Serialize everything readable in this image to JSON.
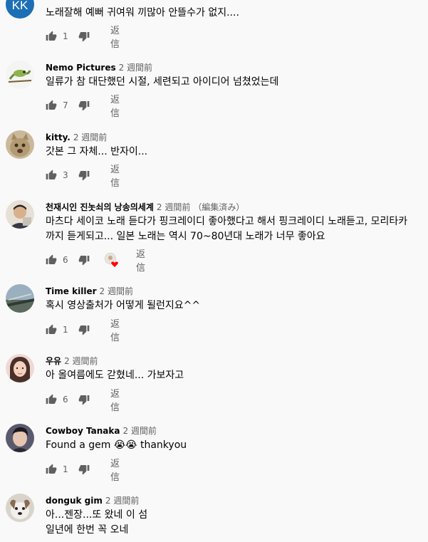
{
  "comments": [
    {
      "avatar": "avatar-kk",
      "avatar_text": "KK",
      "author": "",
      "time": "",
      "text": "노래잘해 예뻐 귀여워 끼많아 안뜰수가 없지....",
      "likes": "1",
      "reply": "返信"
    },
    {
      "avatar": "avatar-chameleon",
      "author": "Nemo Pictures",
      "time": "2 週間前",
      "text": "일류가 참 대단했던 시절, 세련되고 아이디어 넘쳤었는데",
      "likes": "7",
      "reply": "返信"
    },
    {
      "avatar": "avatar-cat",
      "author": "kitty.",
      "time": "2 週間前",
      "text": "갓본 그 자체... 반자이...",
      "likes": "3",
      "reply": "返信"
    },
    {
      "avatar": "avatar-man",
      "author": "천재시인 진놋쇠의 낭송의세계",
      "time": "2 週間前",
      "edited": "（編集済み）",
      "text": "마츠다 세이코 노래 듣다가 핑크레이디 좋아했다고 해서 핑크레이디 노래듣고, 모리타카\n까지 듣게되고... 일본 노래는 역시 70~80년대 노래가 너무 좋아요",
      "likes": "6",
      "reply": "返信",
      "creator_heart": true
    },
    {
      "avatar": "avatar-road",
      "author": "Time killer",
      "time": "2 週間前",
      "text": "혹시 영상출처가 어떻게 될런지요^^",
      "likes": "1",
      "reply": "返信"
    },
    {
      "avatar": "avatar-girl",
      "author": "우유",
      "time": "2 週間前",
      "text": "아 올여름에도 갇혔네... 가보자고",
      "likes": "6",
      "reply": "返信"
    },
    {
      "avatar": "avatar-person",
      "author": "Cowboy Tanaka",
      "time": "2 週間前",
      "text": "Found a gem 😭😭 thankyou",
      "likes": "1",
      "reply": "返信"
    },
    {
      "avatar": "avatar-dog",
      "author": "donguk gim",
      "time": "2 週間前",
      "text": "아...젠장...또 왔네 이 섬\n일년에 한번 꼭 오네",
      "likes": "",
      "reply": ""
    }
  ],
  "colors": {
    "background": "#f9f9f9",
    "text": "#030303",
    "secondary": "#606060",
    "heart": "#ff0000"
  },
  "icons": {
    "like": "thumbs-up-icon",
    "dislike": "thumbs-down-icon",
    "heart": "creator-heart-icon"
  }
}
